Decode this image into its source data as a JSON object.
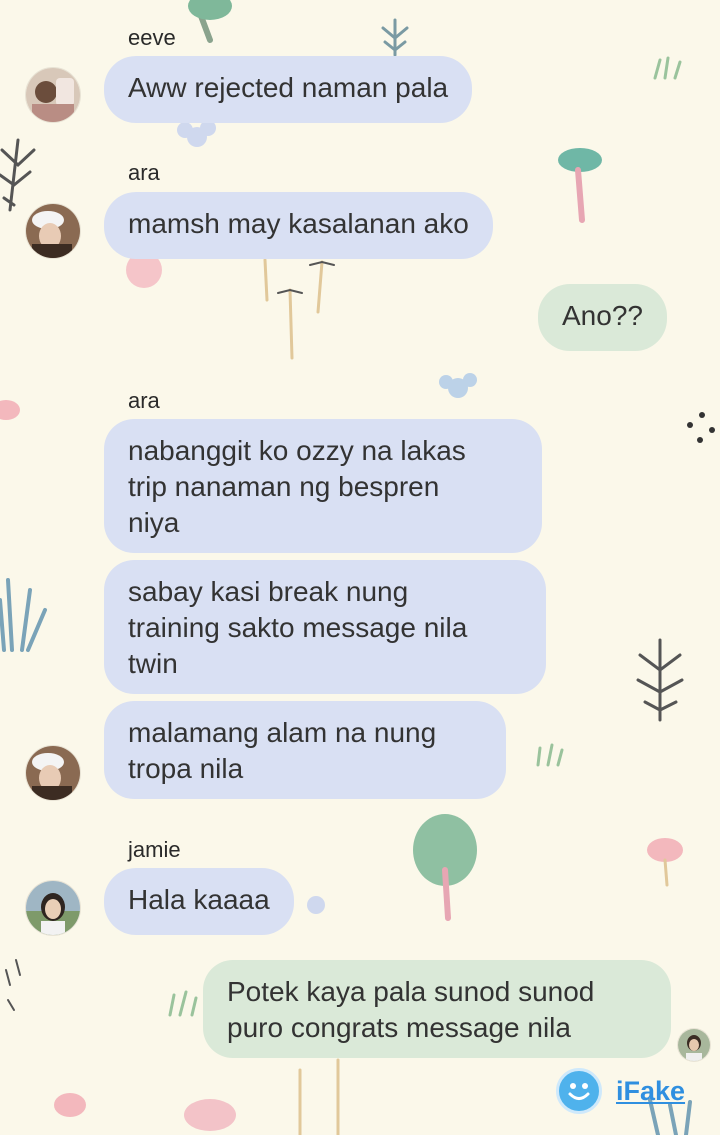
{
  "colors": {
    "background": "#fbf8ea",
    "incoming_bubble": "#d9e0f3",
    "outgoing_bubble": "#dae9d8",
    "brand": "#2f8fe0"
  },
  "messages": [
    {
      "sender": "eeve",
      "text": "Aww rejected naman pala"
    },
    {
      "sender": "ara",
      "text": "mamsh may kasalanan ako"
    },
    {
      "sender": "",
      "text": "Ano??"
    },
    {
      "sender": "ara",
      "text": "nabanggit ko ozzy na lakas\ntrip nanaman ng bespren\nniya"
    },
    {
      "sender": "",
      "text": "sabay kasi break nung\ntraining sakto message nila\ntwin"
    },
    {
      "sender": "",
      "text": "malamang alam na nung\ntropa nila"
    },
    {
      "sender": "jamie",
      "text": "Hala kaaaa"
    },
    {
      "sender": "",
      "text": "Potek kaya pala sunod sunod\npuro congrats message nila"
    }
  ],
  "watermark": {
    "icon": "smiley-icon",
    "label": "iFake"
  }
}
